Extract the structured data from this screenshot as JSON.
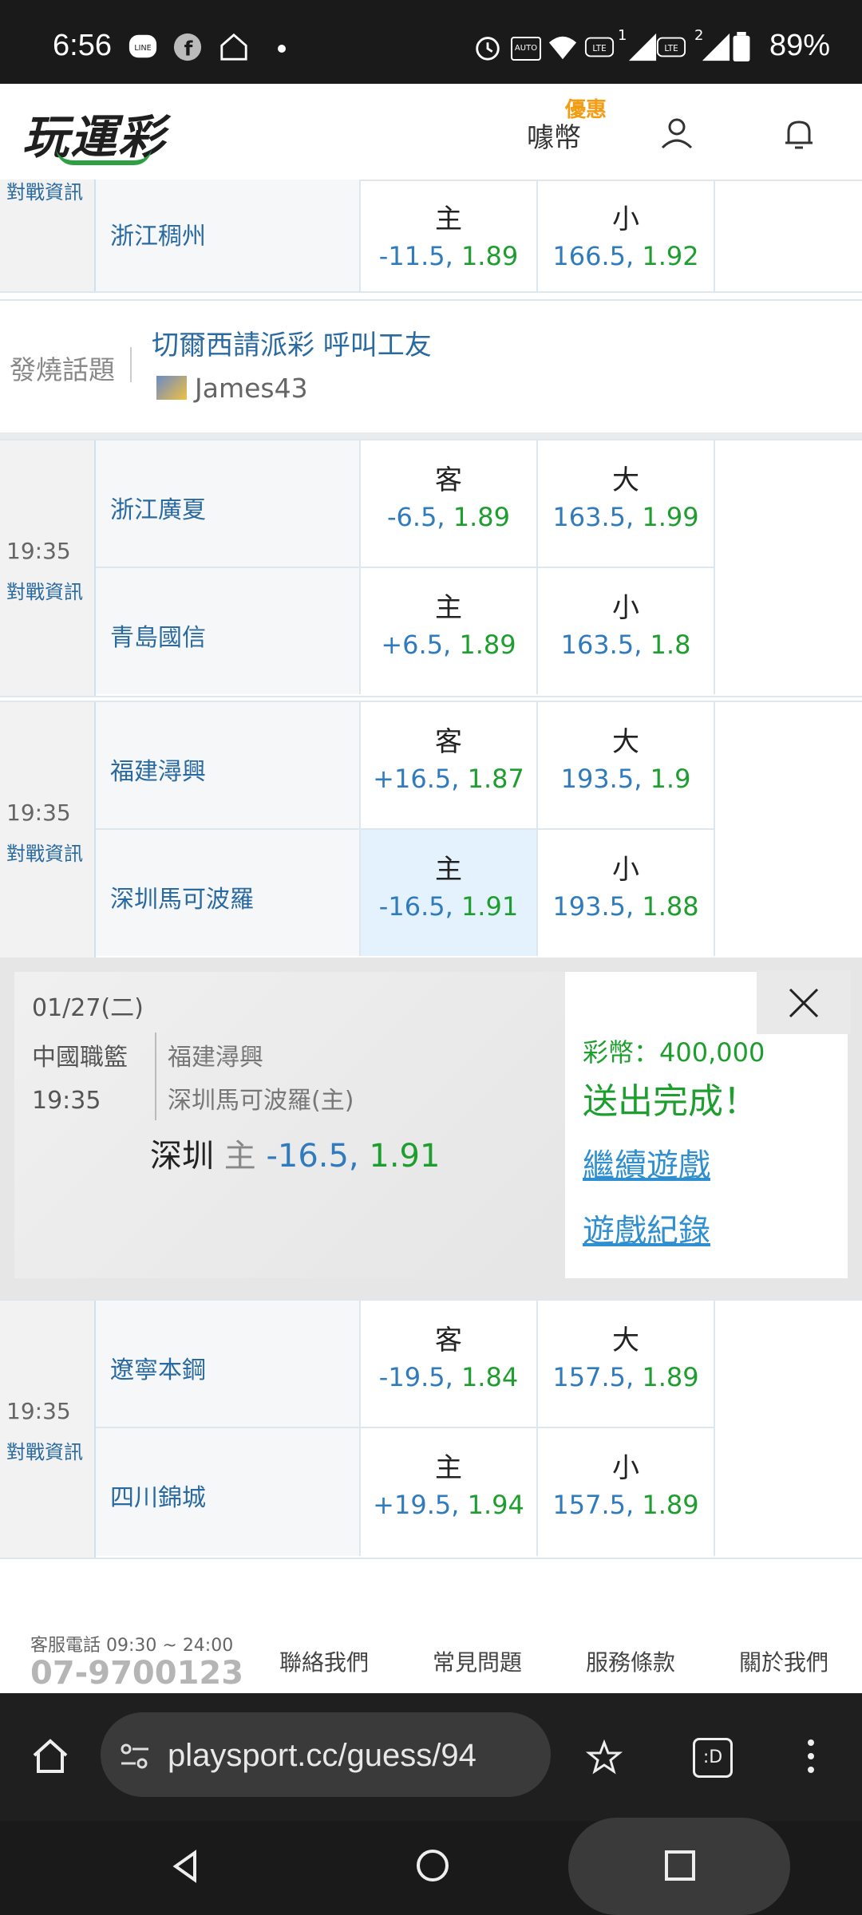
{
  "status_bar": {
    "time": "6:56",
    "battery": "89%",
    "sim1": "1",
    "sim2": "2",
    "network_tag": "AUTO"
  },
  "header": {
    "logo_text": "玩運彩",
    "promo_badge": "優惠",
    "coin_label": "噱幣"
  },
  "matches": [
    {
      "time": "",
      "vs_info": "對戰資訊",
      "teams": [
        {
          "name": "浙江稠州",
          "handicap_side": "主",
          "handicap": "-11.5, 1.89",
          "total_side": "小",
          "total": "166.5, 1.92"
        }
      ]
    },
    {
      "time": "19:35",
      "vs_info": "對戰資訊",
      "teams": [
        {
          "name": "浙江廣夏",
          "handicap_side": "客",
          "handicap": "-6.5, 1.89",
          "total_side": "大",
          "total": "163.5, 1.99"
        },
        {
          "name": "青島國信",
          "handicap_side": "主",
          "handicap": "+6.5, 1.89",
          "total_side": "小",
          "total": "163.5, 1.8"
        }
      ]
    },
    {
      "time": "19:35",
      "vs_info": "對戰資訊",
      "teams": [
        {
          "name": "福建潯興",
          "handicap_side": "客",
          "handicap": "+16.5, 1.87",
          "total_side": "大",
          "total": "193.5, 1.9"
        },
        {
          "name": "深圳馬可波羅",
          "handicap_side": "主",
          "handicap": "-16.5, 1.91",
          "total_side": "小",
          "total": "193.5, 1.88"
        }
      ]
    },
    {
      "time": "19:35",
      "vs_info": "對戰資訊",
      "teams": [
        {
          "name": "遼寧本鋼",
          "handicap_side": "客",
          "handicap": "-19.5, 1.84",
          "total_side": "大",
          "total": "157.5, 1.89"
        },
        {
          "name": "四川錦城",
          "handicap_side": "主",
          "handicap": "+19.5, 1.94",
          "total_side": "小",
          "total": "157.5, 1.89"
        }
      ]
    }
  ],
  "topic": {
    "label": "發燒話題",
    "title": "切爾西請派彩 呼叫工友",
    "user": "James43"
  },
  "popup": {
    "date": "01/27(二)",
    "league": "中國職籃",
    "time": "19:35",
    "team1": "福建潯興",
    "team2": "深圳馬可波羅(主)",
    "pick_team": "深圳",
    "pick_side": "主",
    "pick_line": "-16.5,",
    "pick_odds": "1.91",
    "coins": "彩幣：400,000",
    "done": "送出完成！",
    "continue": "繼續遊戲",
    "records": "遊戲紀錄"
  },
  "footer": {
    "phone_label": "客服電話 09:30 ~ 24:00",
    "phone": "07-9700123",
    "links": [
      "聯絡我們",
      "常見問題",
      "服務條款",
      "關於我們"
    ]
  },
  "browser": {
    "url": "playsport.cc/guess/94",
    "tab_icon": ":D"
  },
  "colors": {
    "odds_green": "#1e9e2f",
    "odds_blue": "#2f7bbd",
    "link_blue": "#2f8fd0",
    "promo_orange": "#f39c12",
    "selected_bg": "#e3f2fc"
  },
  "icons": [
    "line-icon",
    "facebook-icon",
    "home-app-icon",
    "alarm-icon",
    "wifi-icon",
    "signal-icon",
    "battery-icon",
    "user-icon",
    "bell-icon",
    "close-icon",
    "home-icon",
    "site-settings-icon",
    "star-icon",
    "tabs-icon",
    "menu-icon",
    "back-icon",
    "home-nav-icon",
    "recents-icon"
  ]
}
